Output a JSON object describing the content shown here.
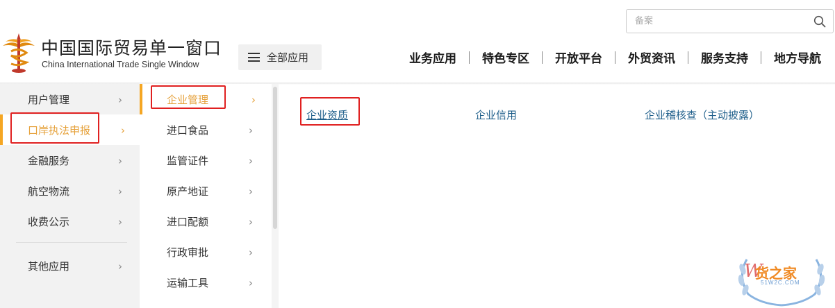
{
  "header": {
    "search": {
      "placeholder": "备案",
      "icon": "search-icon"
    },
    "logo": {
      "cn": "中国国际贸易单一窗口",
      "en": "China International Trade Single Window",
      "icon": "customs-emblem-icon"
    },
    "all_apps": {
      "label": "全部应用",
      "icon": "menu-icon"
    },
    "nav": [
      "业务应用",
      "特色专区",
      "开放平台",
      "外贸资讯",
      "服务支持",
      "地方导航"
    ]
  },
  "menu": {
    "level1": [
      {
        "label": "用户管理",
        "active": false
      },
      {
        "label": "口岸执法申报",
        "active": true
      },
      {
        "label": "金融服务",
        "active": false
      },
      {
        "label": "航空物流",
        "active": false
      },
      {
        "label": "收费公示",
        "active": false
      },
      {
        "label": "其他应用",
        "active": false
      }
    ],
    "level2": [
      {
        "label": "企业管理",
        "active": true
      },
      {
        "label": "进口食品",
        "active": false
      },
      {
        "label": "监管证件",
        "active": false
      },
      {
        "label": "原产地证",
        "active": false
      },
      {
        "label": "进口配额",
        "active": false
      },
      {
        "label": "行政审批",
        "active": false
      },
      {
        "label": "运输工具",
        "active": false
      }
    ],
    "level3": [
      "企业资质",
      "企业信用",
      "企业稽核查（主动披露）"
    ],
    "chevron": "›"
  },
  "watermark": {
    "text": "货之家",
    "sub": "51W2C.COM",
    "letter": "W"
  },
  "colors": {
    "accent": "#f5a623",
    "link": "#1f5f8b",
    "highlight_box": "#e02020"
  }
}
